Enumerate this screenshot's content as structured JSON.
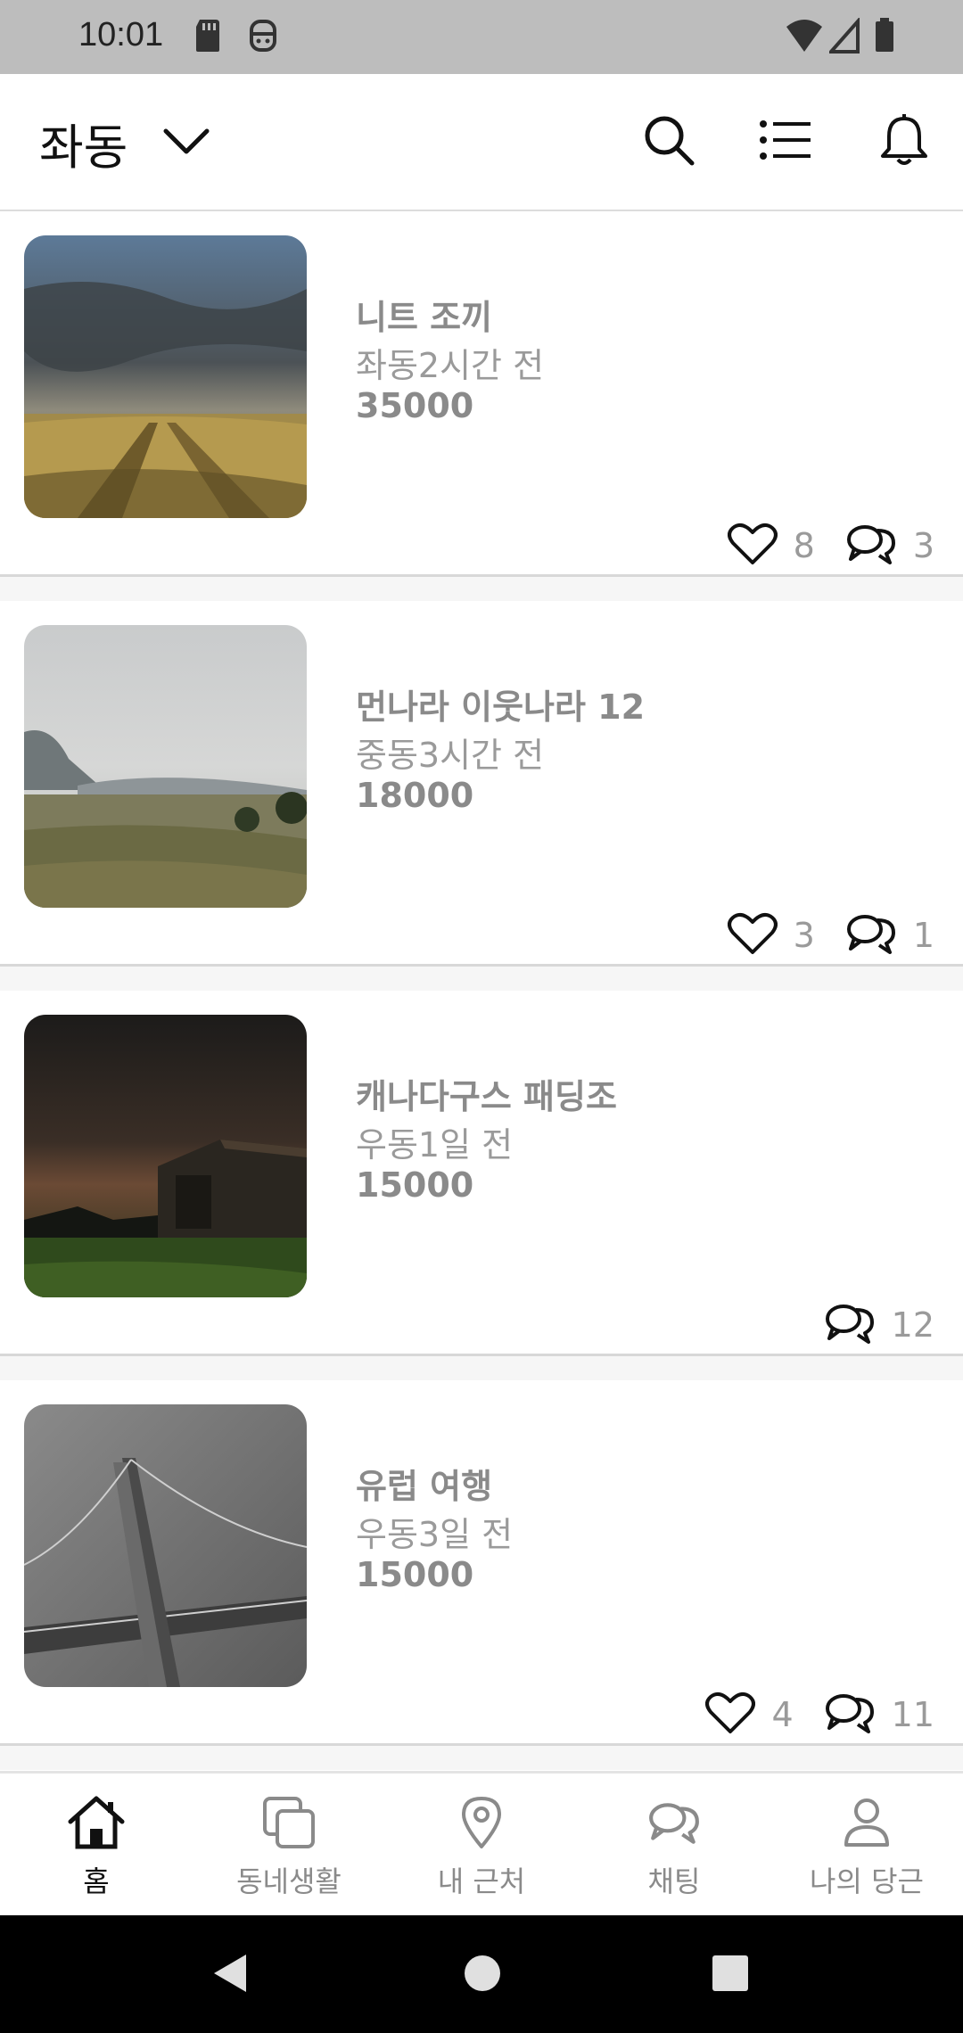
{
  "status_bar": {
    "time": "10:01",
    "icons": [
      "sd-card-icon",
      "face-icon",
      "wifi-icon",
      "signal-icon",
      "battery-icon"
    ]
  },
  "header": {
    "location": "좌동",
    "icons": [
      "chevron-down-icon",
      "search-icon",
      "list-icon",
      "bell-icon"
    ]
  },
  "listings": [
    {
      "title": "니트 조끼",
      "meta": "좌동2시간 전",
      "price": "35000",
      "likes": "8",
      "chats": "3",
      "image": "field-sky-photo"
    },
    {
      "title": "먼나라 이웃나라 12",
      "meta": "중동3시간 전",
      "price": "18000",
      "likes": "3",
      "chats": "1",
      "image": "valley-photo"
    },
    {
      "title": "캐나다구스 패딩조",
      "meta": "우동1일 전",
      "price": "15000",
      "likes": "",
      "chats": "12",
      "image": "barn-night-photo"
    },
    {
      "title": "유럽 여행",
      "meta": "우동3일 전",
      "price": "15000",
      "likes": "4",
      "chats": "11",
      "image": "bridge-photo"
    }
  ],
  "bottom_nav": {
    "tabs": [
      {
        "label": "홈",
        "icon": "home-icon",
        "active": true
      },
      {
        "label": "동네생활",
        "icon": "copy-icon",
        "active": false
      },
      {
        "label": "내 근처",
        "icon": "location-pin-icon",
        "active": false
      },
      {
        "label": "채팅",
        "icon": "chat-icon",
        "active": false
      },
      {
        "label": "나의 당근",
        "icon": "person-icon",
        "active": false
      }
    ]
  },
  "system_nav": {
    "buttons": [
      "back-icon",
      "home-circle-icon",
      "recents-icon"
    ]
  },
  "colors": {
    "accent_text": "#111111",
    "muted_text": "#8a8a8a",
    "divider": "#d8d8d8",
    "status_bar": "#bdbdbd"
  }
}
